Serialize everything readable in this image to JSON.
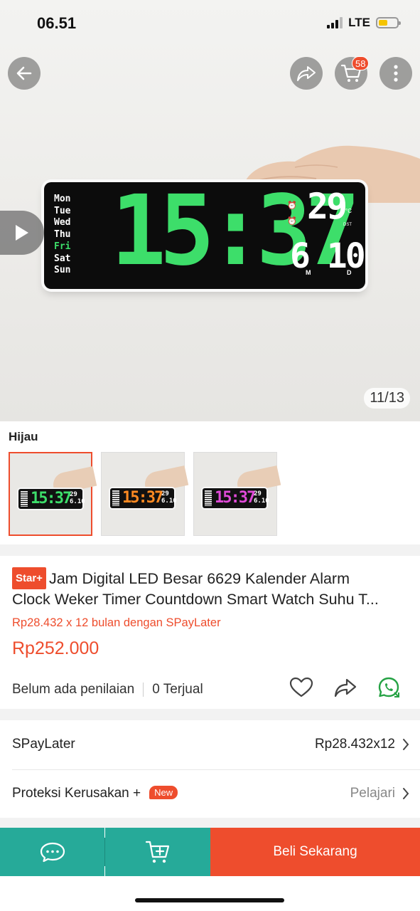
{
  "status_bar": {
    "time": "06.51",
    "network": "LTE"
  },
  "header": {
    "cart_count": "58",
    "icons": [
      "back-arrow-icon",
      "share-icon",
      "cart-icon",
      "more-vertical-icon"
    ]
  },
  "gallery": {
    "counter": "11/13",
    "clock_display": {
      "days": [
        "Mon",
        "Tue",
        "Wed",
        "Thu",
        "Fri",
        "Sat",
        "Sun"
      ],
      "active_day": "Fri",
      "time": "15:37",
      "temperature": "29",
      "temp_unit": "°C",
      "dst": "DST",
      "date": "6 10",
      "month_label": "M",
      "day_label": "D"
    }
  },
  "variants": {
    "label": "Hijau",
    "options": [
      {
        "name": "green",
        "color": "#3dde6a",
        "selected": true
      },
      {
        "name": "orange",
        "color": "#ff8a22",
        "selected": false
      },
      {
        "name": "magenta",
        "color": "#e04ad8",
        "selected": false
      }
    ],
    "mini_time": "15:37",
    "mini_side": "29\n6 10"
  },
  "product": {
    "tag": "Star+",
    "title_line1": "Jam Digital LED Besar 6629 Kalender Alarm",
    "title_line2": "Clock Weker Timer Countdown Smart Watch Suhu T...",
    "installment": "Rp28.432 x 12 bulan dengan SPayLater",
    "price": "Rp252.000",
    "rating_text": "Belum ada penilaian",
    "sold_text": "0 Terjual"
  },
  "rows": {
    "spaylater_label": "SPayLater",
    "spaylater_value": "Rp28.432x12",
    "protection_label": "Proteksi Kerusakan +",
    "protection_tag": "New",
    "protection_action": "Pelajari"
  },
  "bottom_bar": {
    "buy_label": "Beli Sekarang"
  },
  "colors": {
    "accent": "#ee4d2d",
    "teal": "#26aa99",
    "whatsapp": "#25a244"
  }
}
